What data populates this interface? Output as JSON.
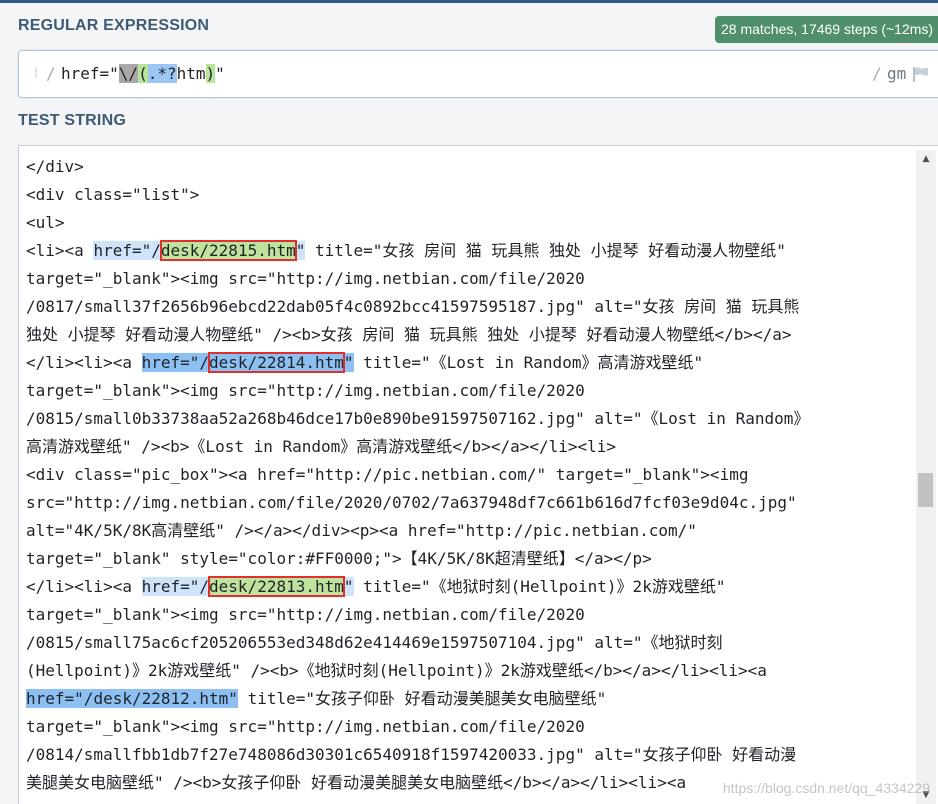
{
  "regex_section": {
    "title": "REGULAR EXPRESSION",
    "match_info": "28 matches, 17469 steps (~12ms)",
    "delimiter_open": "/",
    "pattern_parts": {
      "prefix": "href=\"",
      "escaped_slash": "\\/",
      "group_open": "(",
      "lazy_any": ".*?",
      "literal": "htm",
      "group_close": ")",
      "suffix": "\""
    },
    "delimiter_close": "/",
    "flags": "gm",
    "flag_icon": "flag-icon"
  },
  "test_section": {
    "title": "TEST STRING",
    "lines": [
      {
        "segments": [
          {
            "t": "</div>"
          }
        ]
      },
      {
        "segments": [
          {
            "t": "<div class=\"list\">"
          }
        ]
      },
      {
        "segments": [
          {
            "t": "<ul>"
          }
        ]
      },
      {
        "segments": [
          {
            "t": "<li><a "
          },
          {
            "t": "href=\"/",
            "m": true
          },
          {
            "t": "desk/22815.htm",
            "m": true,
            "g": true,
            "box": true
          },
          {
            "t": "\"",
            "m": true
          },
          {
            "t": " title=\"女孩 房间 猫 玩具熊 独处 小提琴 好看动漫人物壁纸\""
          }
        ]
      },
      {
        "segments": [
          {
            "t": "target=\"_blank\"><img src=\"http://img.netbian.com/file/2020"
          }
        ]
      },
      {
        "segments": [
          {
            "t": "/0817/small37f2656b96ebcd22dab05f4c0892bcc41597595187.jpg\" alt=\"女孩 房间 猫 玩具熊"
          }
        ]
      },
      {
        "segments": [
          {
            "t": "独处 小提琴 好看动漫人物壁纸\" /><b>女孩 房间 猫 玩具熊 独处 小提琴 好看动漫人物壁纸</b></a>"
          }
        ]
      },
      {
        "segments": [
          {
            "t": "</li><li><a "
          },
          {
            "t": "href=\"/",
            "m": true,
            "alt": true
          },
          {
            "t": "desk/22814.htm",
            "m": true,
            "alt": true,
            "g": true,
            "box": true
          },
          {
            "t": "\"",
            "m": true,
            "alt": true
          },
          {
            "t": " title=\"《Lost in Random》高清游戏壁纸\""
          }
        ]
      },
      {
        "segments": [
          {
            "t": "target=\"_blank\"><img src=\"http://img.netbian.com/file/2020"
          }
        ]
      },
      {
        "segments": [
          {
            "t": "/0815/small0b33738aa52a268b46dce17b0e890be91597507162.jpg\" alt=\"《Lost in Random》"
          }
        ]
      },
      {
        "segments": [
          {
            "t": "高清游戏壁纸\" /><b>《Lost in Random》高清游戏壁纸</b></a></li><li>"
          }
        ]
      },
      {
        "segments": [
          {
            "t": "<div class=\"pic_box\"><a href=\"http://pic.netbian.com/\" target=\"_blank\"><img"
          }
        ]
      },
      {
        "segments": [
          {
            "t": "src=\"http://img.netbian.com/file/2020/0702/7a637948df7c661b616d7fcf03e9d04c.jpg\""
          }
        ]
      },
      {
        "segments": [
          {
            "t": "alt=\"4K/5K/8K高清壁纸\" /></a></div><p><a href=\"http://pic.netbian.com/\""
          }
        ]
      },
      {
        "segments": [
          {
            "t": "target=\"_blank\" style=\"color:#FF0000;\">【4K/5K/8K超清壁纸】</a></p>"
          }
        ]
      },
      {
        "segments": [
          {
            "t": "</li><li><a "
          },
          {
            "t": "href=\"/",
            "m": true
          },
          {
            "t": "desk/22813.htm",
            "m": true,
            "g": true,
            "box": true
          },
          {
            "t": "\"",
            "m": true
          },
          {
            "t": " title=\"《地狱时刻(Hellpoint)》2k游戏壁纸\""
          }
        ]
      },
      {
        "segments": [
          {
            "t": "target=\"_blank\"><img src=\"http://img.netbian.com/file/2020"
          }
        ]
      },
      {
        "segments": [
          {
            "t": "/0815/small75ac6cf205206553ed348d62e414469e1597507104.jpg\" alt=\"《地狱时刻"
          }
        ]
      },
      {
        "segments": [
          {
            "t": "(Hellpoint)》2k游戏壁纸\" /><b>《地狱时刻(Hellpoint)》2k游戏壁纸</b></a></li><li><a"
          }
        ]
      },
      {
        "segments": [
          {
            "t": "href=\"/",
            "m": true,
            "alt": true
          },
          {
            "t": "desk/22812.htm",
            "m": true,
            "alt": true,
            "g": true
          },
          {
            "t": "\"",
            "m": true,
            "alt": true
          },
          {
            "t": " title=\"女孩子仰卧 好看动漫美腿美女电脑壁纸\""
          }
        ]
      },
      {
        "segments": [
          {
            "t": "target=\"_blank\"><img src=\"http://img.netbian.com/file/2020"
          }
        ]
      },
      {
        "segments": [
          {
            "t": "/0814/smallfbb1db7f27e748086d30301c6540918f1597420033.jpg\" alt=\"女孩子仰卧 好看动漫"
          }
        ]
      },
      {
        "segments": [
          {
            "t": "美腿美女电脑壁纸\" /><b>女孩子仰卧 好看动漫美腿美女电脑壁纸</b></a></li><li><a"
          }
        ]
      }
    ]
  },
  "scrollbar": {
    "up_arrow": "▲",
    "down_arrow": "▼"
  },
  "watermark": "https://blog.csdn.net/qq_4334229"
}
